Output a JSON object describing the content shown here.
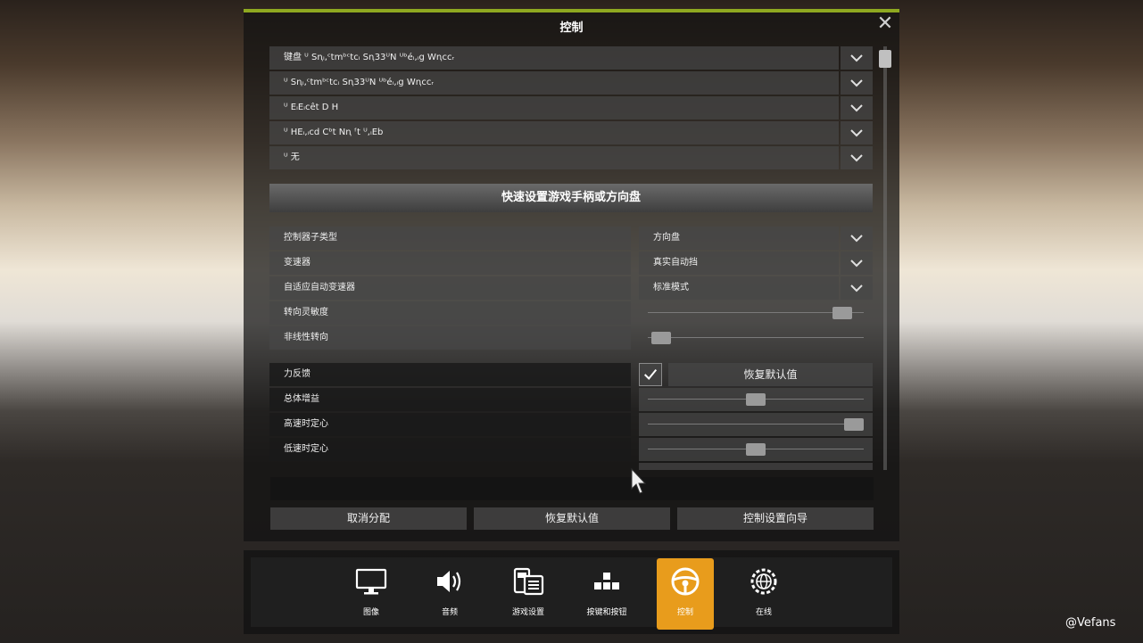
{
  "window": {
    "title": "控制",
    "close_glyph": "✕"
  },
  "device_list": [
    "键盘 ᵁ Sꞑᵢ,ᶜtmᵇᶜtcᵢ Sꞑ33ᵁN ᵁᵇéᵢ,ᵢg Wꞑccᵣ",
    "ᵁ Sꞑᵢ,ᶜtmᵇᶜtcᵢ Sꞑ33ᵁN ᵁᵇéᵢ,ᵢg Wꞑccᵣ",
    "ᵁ EᵢEᵢcêt D H",
    "ᵁ HEᵢ,ᵢcd Cᵇt Nꞑ ᶠt ᵁ,ᵢEb",
    "ᵁ 无"
  ],
  "quick_setup": {
    "label": "快速设置游戏手柄或方向盘"
  },
  "settings": {
    "controller_subtype": {
      "label": "控制器子类型",
      "value": "方向盘"
    },
    "transmission": {
      "label": "变速器",
      "value": "真实自动挡"
    },
    "adaptive_transmission": {
      "label": "自适应自动变速器",
      "value": "标准模式"
    },
    "steering_sensitivity": {
      "label": "转向灵敏度",
      "level": 0.94
    },
    "nonlinear_steering": {
      "label": "非线性转向",
      "level": 0.02
    }
  },
  "force_feedback": {
    "label": "力反馈",
    "checked": true,
    "reset_label": "恢复默认值",
    "overall_gain": {
      "label": "总体增益",
      "level": 0.5
    },
    "high_speed_centering": {
      "label": "高速时定心",
      "level": 1.0
    },
    "low_speed_centering": {
      "label": "低速时定心",
      "level": 0.5
    }
  },
  "buttons": {
    "unassign": "取消分配",
    "restore_defaults": "恢复默认值",
    "setup_wizard": "控制设置向导"
  },
  "nav": [
    {
      "label": "图像",
      "icon": "monitor-icon",
      "active": false
    },
    {
      "label": "音频",
      "icon": "speaker-icon",
      "active": false
    },
    {
      "label": "游戏设置",
      "icon": "game-settings-icon",
      "active": false
    },
    {
      "label": "按键和按钮",
      "icon": "keys-icon",
      "active": false
    },
    {
      "label": "控制",
      "icon": "steering-wheel-icon",
      "active": true
    },
    {
      "label": "在线",
      "icon": "globe-gear-icon",
      "active": false
    }
  ],
  "watermark": "@Vefans",
  "colors": {
    "accent": "#8ea820",
    "active_tab": "#e89c1c"
  }
}
